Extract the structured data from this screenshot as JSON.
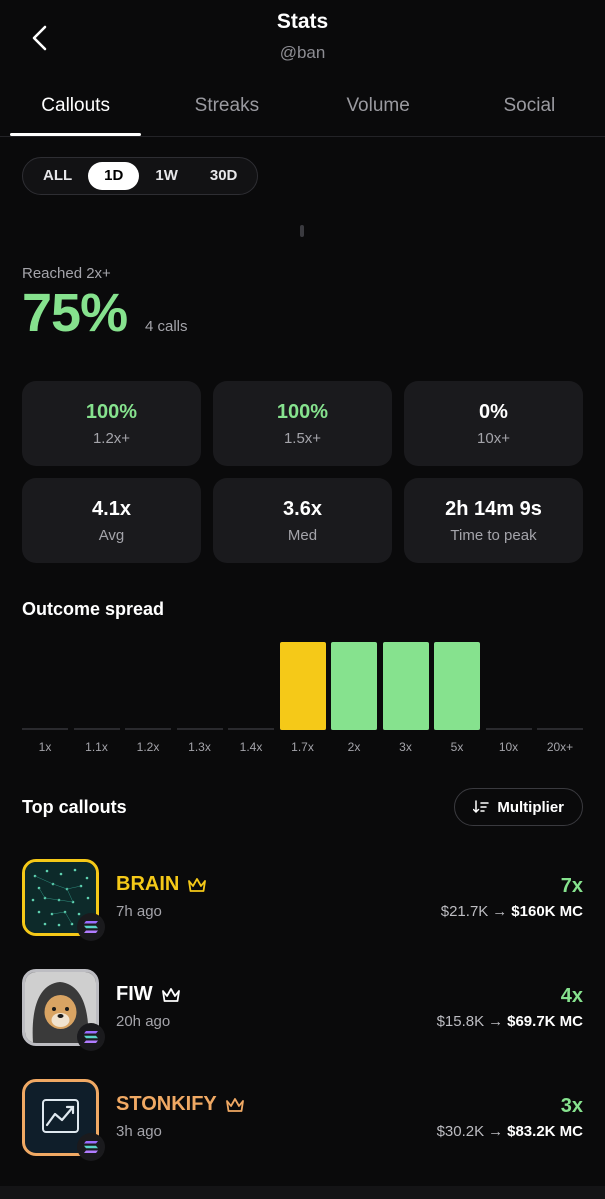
{
  "header": {
    "title": "Stats",
    "handle": "@ban"
  },
  "tabs": [
    {
      "label": "Callouts",
      "active": true
    },
    {
      "label": "Streaks",
      "active": false
    },
    {
      "label": "Volume",
      "active": false
    },
    {
      "label": "Social",
      "active": false
    }
  ],
  "range": {
    "options": [
      "ALL",
      "1D",
      "1W",
      "30D"
    ],
    "selected": "1D"
  },
  "reached": {
    "label": "Reached 2x+",
    "percent": "75%",
    "calls": "4 calls"
  },
  "stats": [
    {
      "value": "100%",
      "label": "1.2x+",
      "highlight": true
    },
    {
      "value": "100%",
      "label": "1.5x+",
      "highlight": true
    },
    {
      "value": "0%",
      "label": "10x+",
      "highlight": false
    },
    {
      "value": "4.1x",
      "label": "Avg",
      "highlight": false
    },
    {
      "value": "3.6x",
      "label": "Med",
      "highlight": false
    },
    {
      "value": "2h 14m 9s",
      "label": "Time to peak",
      "highlight": false
    }
  ],
  "chart_data": {
    "type": "bar",
    "title": "Outcome spread",
    "categories": [
      "1x",
      "1.1x",
      "1.2x",
      "1.3x",
      "1.4x",
      "1.7x",
      "2x",
      "3x",
      "5x",
      "10x",
      "20x+"
    ],
    "values": [
      0,
      0,
      0,
      0,
      0,
      1,
      1,
      1,
      1,
      0,
      0
    ],
    "bar_colors": [
      "#86e28e",
      "#86e28e",
      "#86e28e",
      "#86e28e",
      "#86e28e",
      "#f5c918",
      "#86e28e",
      "#86e28e",
      "#86e28e",
      "#86e28e",
      "#86e28e"
    ],
    "ylim": [
      0,
      1
    ],
    "grid": false
  },
  "top": {
    "title": "Top callouts",
    "sort_label": "Multiplier",
    "items": [
      {
        "name": "BRAIN",
        "name_color": "#f5c918",
        "ago": "7h ago",
        "multiplier": "7x",
        "from_mc": "$21.7K",
        "to_mc": "$160K",
        "mc_suffix": "MC",
        "border": "#f5c918",
        "avatar": "brain"
      },
      {
        "name": "FIW",
        "name_color": "#ffffff",
        "ago": "20h ago",
        "multiplier": "4x",
        "from_mc": "$15.8K",
        "to_mc": "$69.7K",
        "mc_suffix": "MC",
        "border": "#bdbdc2",
        "avatar": "dog"
      },
      {
        "name": "STONKIFY",
        "name_color": "#f0a964",
        "ago": "3h ago",
        "multiplier": "3x",
        "from_mc": "$30.2K",
        "to_mc": "$83.2K",
        "mc_suffix": "MC",
        "border": "#f0a964",
        "avatar": "chart"
      }
    ]
  },
  "colors": {
    "accent_green": "#86e28e",
    "accent_yellow": "#f5c918",
    "background": "#0a0a0b",
    "card": "#1a1a1d"
  }
}
